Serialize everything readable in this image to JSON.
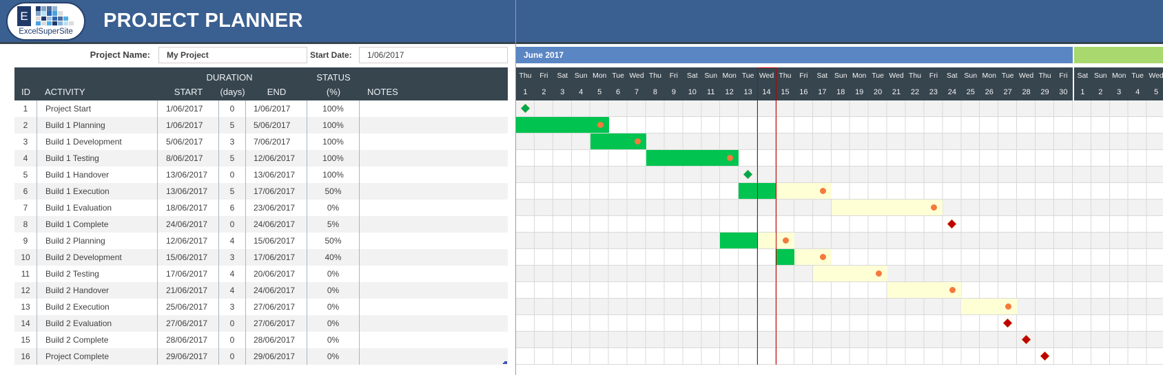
{
  "app": {
    "title": "PROJECT PLANNER",
    "logo_letter": "E",
    "logo_text": "ExcelSuperSite"
  },
  "project": {
    "name_label": "Project Name:",
    "name_value": "My Project",
    "start_label": "Start Date:",
    "start_value": "1/06/2017"
  },
  "table": {
    "headers": {
      "id": "ID",
      "activity": "ACTIVITY",
      "start": "START",
      "duration_top": "DURATION",
      "duration": "(days)",
      "end": "END",
      "status_top": "STATUS",
      "status": "(%)",
      "notes": "NOTES"
    },
    "rows": [
      {
        "id": "1",
        "activity": "Project Start",
        "start": "1/06/2017",
        "duration": "0",
        "end": "1/06/2017",
        "status": "100%",
        "notes": ""
      },
      {
        "id": "2",
        "activity": "Build 1 Planning",
        "start": "1/06/2017",
        "duration": "5",
        "end": "5/06/2017",
        "status": "100%",
        "notes": ""
      },
      {
        "id": "3",
        "activity": "Build 1 Development",
        "start": "5/06/2017",
        "duration": "3",
        "end": "7/06/2017",
        "status": "100%",
        "notes": ""
      },
      {
        "id": "4",
        "activity": "Build 1 Testing",
        "start": "8/06/2017",
        "duration": "5",
        "end": "12/06/2017",
        "status": "100%",
        "notes": ""
      },
      {
        "id": "5",
        "activity": "Build 1 Handover",
        "start": "13/06/2017",
        "duration": "0",
        "end": "13/06/2017",
        "status": "100%",
        "notes": ""
      },
      {
        "id": "6",
        "activity": "Build 1 Execution",
        "start": "13/06/2017",
        "duration": "5",
        "end": "17/06/2017",
        "status": "50%",
        "notes": ""
      },
      {
        "id": "7",
        "activity": "Build 1 Evaluation",
        "start": "18/06/2017",
        "duration": "6",
        "end": "23/06/2017",
        "status": "0%",
        "notes": ""
      },
      {
        "id": "8",
        "activity": "Build 1 Complete",
        "start": "24/06/2017",
        "duration": "0",
        "end": "24/06/2017",
        "status": "5%",
        "notes": ""
      },
      {
        "id": "9",
        "activity": "Build 2 Planning",
        "start": "12/06/2017",
        "duration": "4",
        "end": "15/06/2017",
        "status": "50%",
        "notes": ""
      },
      {
        "id": "10",
        "activity": "Build 2 Development",
        "start": "15/06/2017",
        "duration": "3",
        "end": "17/06/2017",
        "status": "40%",
        "notes": ""
      },
      {
        "id": "11",
        "activity": "Build 2 Testing",
        "start": "17/06/2017",
        "duration": "4",
        "end": "20/06/2017",
        "status": "0%",
        "notes": ""
      },
      {
        "id": "12",
        "activity": "Build 2 Handover",
        "start": "21/06/2017",
        "duration": "4",
        "end": "24/06/2017",
        "status": "0%",
        "notes": ""
      },
      {
        "id": "13",
        "activity": "Build 2 Execution",
        "start": "25/06/2017",
        "duration": "3",
        "end": "27/06/2017",
        "status": "0%",
        "notes": ""
      },
      {
        "id": "14",
        "activity": "Build 2 Evaluation",
        "start": "27/06/2017",
        "duration": "0",
        "end": "27/06/2017",
        "status": "0%",
        "notes": ""
      },
      {
        "id": "15",
        "activity": "Build 2 Complete",
        "start": "28/06/2017",
        "duration": "0",
        "end": "28/06/2017",
        "status": "0%",
        "notes": ""
      },
      {
        "id": "16",
        "activity": "Project Complete",
        "start": "29/06/2017",
        "duration": "0",
        "end": "29/06/2017",
        "status": "0%",
        "notes": ""
      }
    ]
  },
  "gantt": {
    "today_day": 14,
    "colors": {
      "complete": "#00c44f",
      "remaining": "#ffffd6",
      "end_marker": "#f47a3c",
      "milestone_done": "#00a650",
      "milestone_pending": "#c00000",
      "today": "#b80000"
    },
    "months": [
      {
        "label": "June 2017",
        "color": "#5b86c4",
        "days": [
          {
            "dow": "Thu",
            "num": "1"
          },
          {
            "dow": "Fri",
            "num": "2"
          },
          {
            "dow": "Sat",
            "num": "3"
          },
          {
            "dow": "Sun",
            "num": "4"
          },
          {
            "dow": "Mon",
            "num": "5"
          },
          {
            "dow": "Tue",
            "num": "6"
          },
          {
            "dow": "Wed",
            "num": "7"
          },
          {
            "dow": "Thu",
            "num": "8"
          },
          {
            "dow": "Fri",
            "num": "9"
          },
          {
            "dow": "Sat",
            "num": "10"
          },
          {
            "dow": "Sun",
            "num": "11"
          },
          {
            "dow": "Mon",
            "num": "12"
          },
          {
            "dow": "Tue",
            "num": "13"
          },
          {
            "dow": "Wed",
            "num": "14"
          },
          {
            "dow": "Thu",
            "num": "15"
          },
          {
            "dow": "Fri",
            "num": "16"
          },
          {
            "dow": "Sat",
            "num": "17"
          },
          {
            "dow": "Sun",
            "num": "18"
          },
          {
            "dow": "Mon",
            "num": "19"
          },
          {
            "dow": "Tue",
            "num": "20"
          },
          {
            "dow": "Wed",
            "num": "21"
          },
          {
            "dow": "Thu",
            "num": "22"
          },
          {
            "dow": "Fri",
            "num": "23"
          },
          {
            "dow": "Sat",
            "num": "24"
          },
          {
            "dow": "Sun",
            "num": "25"
          },
          {
            "dow": "Mon",
            "num": "26"
          },
          {
            "dow": "Tue",
            "num": "27"
          },
          {
            "dow": "Wed",
            "num": "28"
          },
          {
            "dow": "Thu",
            "num": "29"
          },
          {
            "dow": "Fri",
            "num": "30"
          }
        ]
      },
      {
        "label": "",
        "color": "#a9d86e",
        "days": [
          {
            "dow": "Sat",
            "num": "1"
          },
          {
            "dow": "Sun",
            "num": "2"
          },
          {
            "dow": "Mon",
            "num": "3"
          },
          {
            "dow": "Tue",
            "num": "4"
          },
          {
            "dow": "Wed",
            "num": "5"
          }
        ]
      }
    ]
  }
}
